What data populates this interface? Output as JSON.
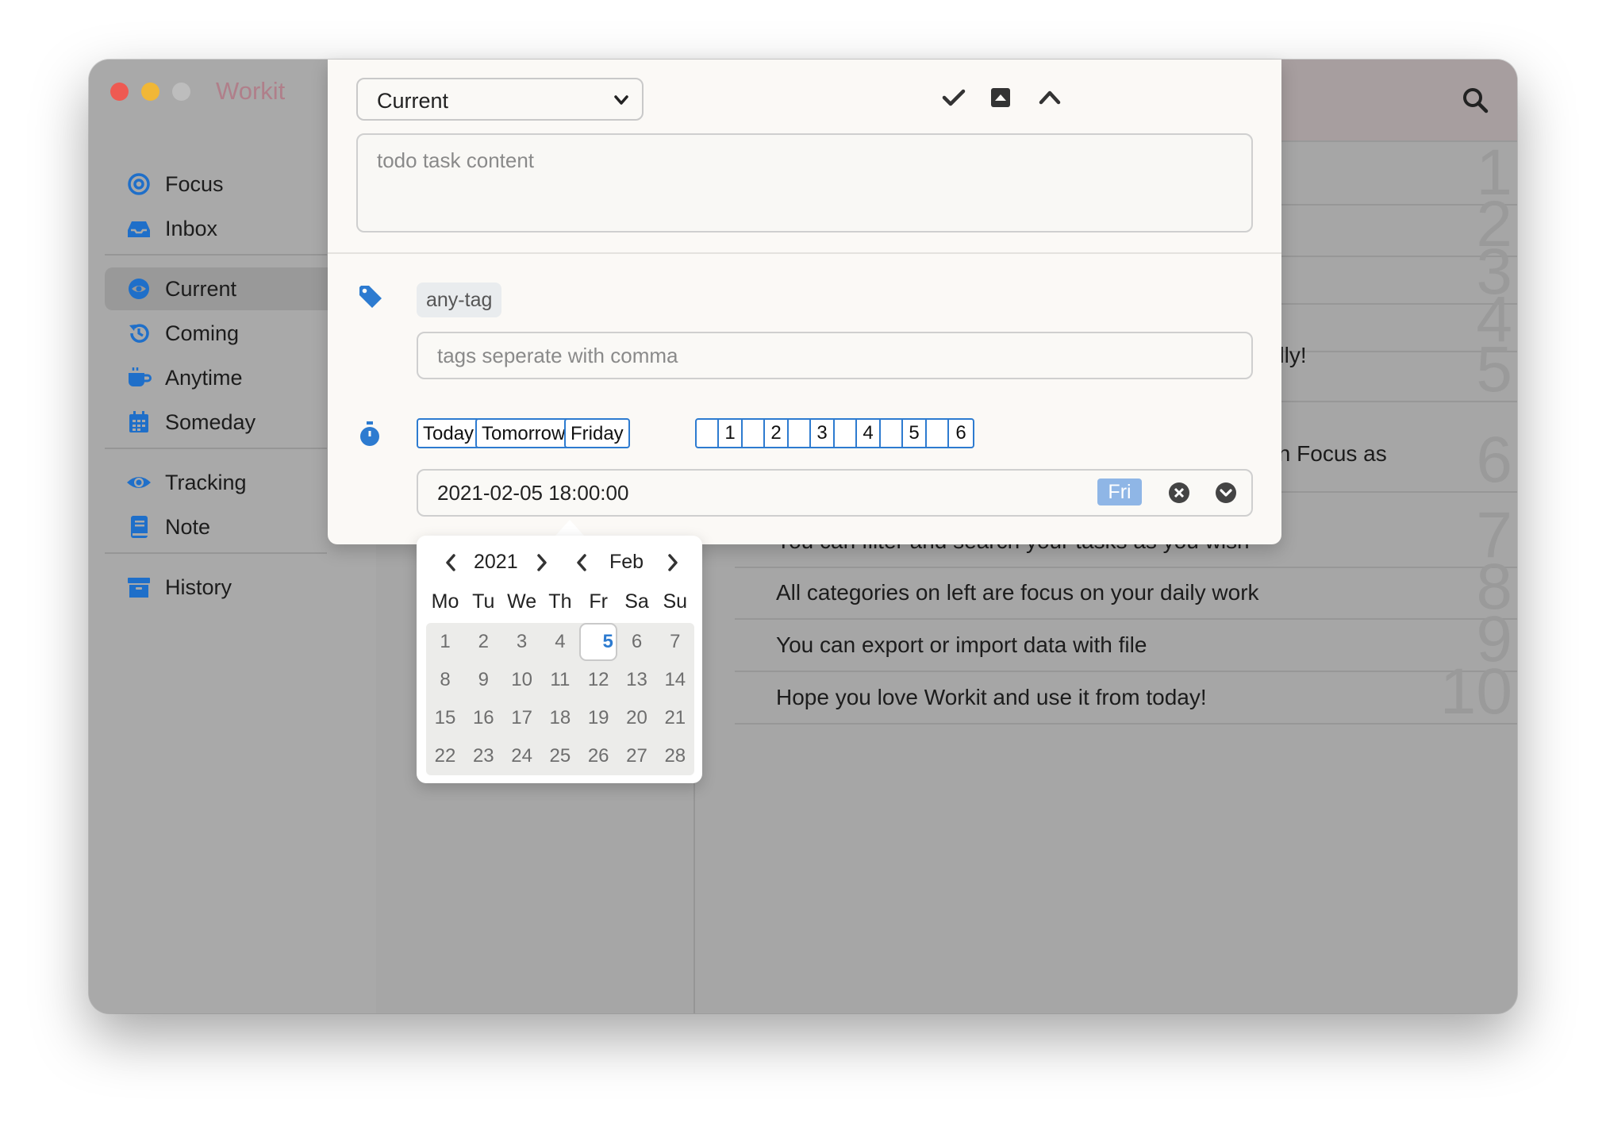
{
  "app": {
    "title": "Workit"
  },
  "sidebar": {
    "groups": [
      [
        {
          "label": "Focus",
          "icon": "target-icon"
        },
        {
          "label": "Inbox",
          "icon": "inbox-icon"
        }
      ],
      [
        {
          "label": "Current",
          "icon": "eye-slash-icon",
          "active": true
        },
        {
          "label": "Coming",
          "icon": "history-icon"
        },
        {
          "label": "Anytime",
          "icon": "coffee-icon"
        },
        {
          "label": "Someday",
          "icon": "calendar-icon"
        }
      ],
      [
        {
          "label": "Tracking",
          "icon": "eye-icon"
        },
        {
          "label": "Note",
          "icon": "book-icon"
        }
      ],
      [
        {
          "label": "History",
          "icon": "archive-icon"
        }
      ]
    ]
  },
  "tasks": [
    {
      "num": "1",
      "text": ""
    },
    {
      "num": "2",
      "text": ""
    },
    {
      "num": "3",
      "text": ""
    },
    {
      "num": "4",
      "text": ""
    },
    {
      "num": "5",
      "text": "utomatically!"
    },
    {
      "num": "6",
      "text": "vill show in Focus as"
    },
    {
      "num": "7",
      "text": "You can filter and search your tasks as you wish"
    },
    {
      "num": "8",
      "text": "All categories on left are focus on your daily work"
    },
    {
      "num": "9",
      "text": "You can export or import data with file"
    },
    {
      "num": "10",
      "text": "Hope you love Workit and use it from today!"
    }
  ],
  "editor": {
    "category": "Current",
    "content_placeholder": "todo task content",
    "tag_chip": "any-tag",
    "tags_placeholder": "tags seperate with comma",
    "quick_dates": [
      "Today",
      "Tomorrow",
      "Friday"
    ],
    "day_offsets": [
      "1",
      "2",
      "3",
      "4",
      "5",
      "6"
    ],
    "datetime": "2021-02-05 18:00:00",
    "weekday": "Fri",
    "accent": "#2d7bd0"
  },
  "calendar": {
    "year": "2021",
    "month": "Feb",
    "weekdays": [
      "Mo",
      "Tu",
      "We",
      "Th",
      "Fr",
      "Sa",
      "Su"
    ],
    "weeks": [
      [
        "1",
        "2",
        "3",
        "4",
        "5",
        "6",
        "7"
      ],
      [
        "8",
        "9",
        "10",
        "11",
        "12",
        "13",
        "14"
      ],
      [
        "15",
        "16",
        "17",
        "18",
        "19",
        "20",
        "21"
      ],
      [
        "22",
        "23",
        "24",
        "25",
        "26",
        "27",
        "28"
      ]
    ],
    "selected": "5"
  }
}
